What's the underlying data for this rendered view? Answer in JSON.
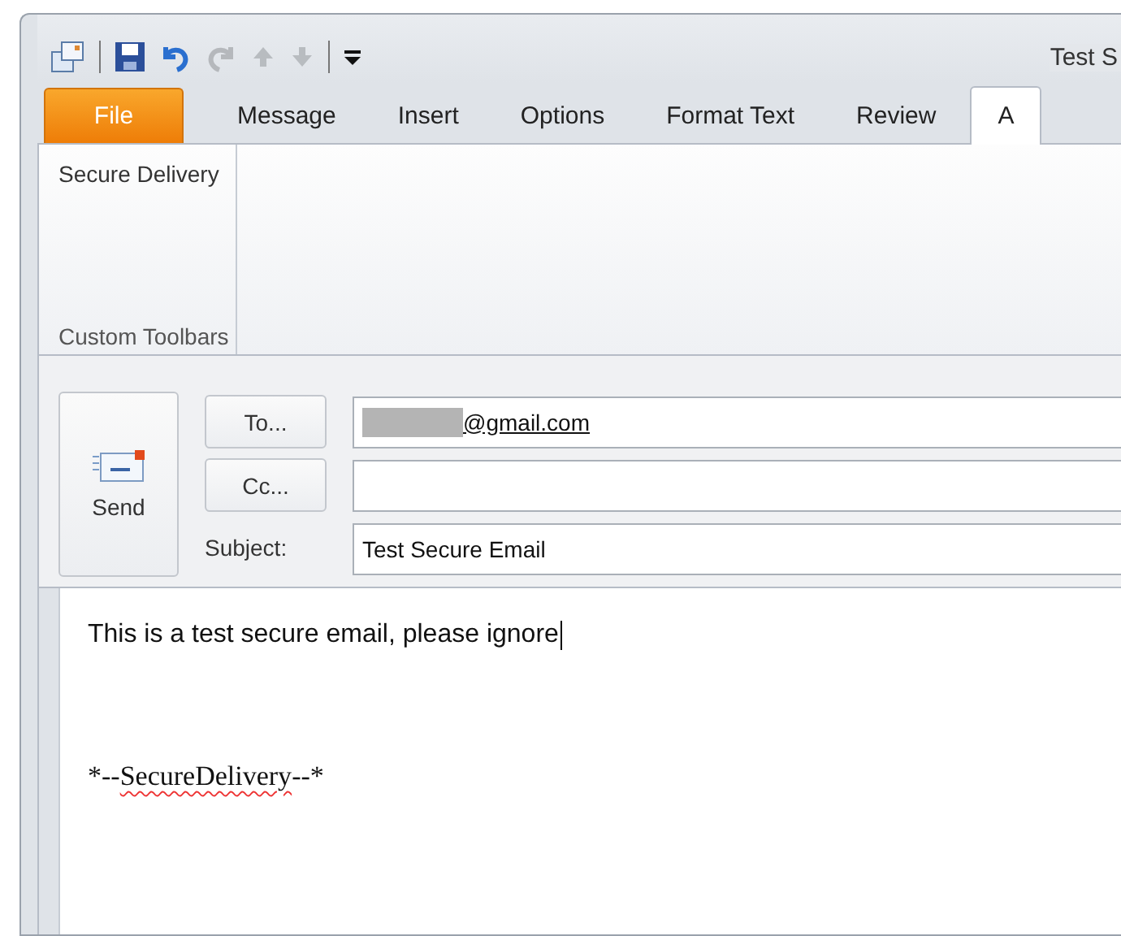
{
  "window": {
    "title": "Test S"
  },
  "tabs": [
    {
      "label": "File",
      "kind": "file",
      "selected": false
    },
    {
      "label": "Message",
      "kind": "tab",
      "selected": false
    },
    {
      "label": "Insert",
      "kind": "tab",
      "selected": false
    },
    {
      "label": "Options",
      "kind": "tab",
      "selected": false
    },
    {
      "label": "Format Text",
      "kind": "tab",
      "selected": false
    },
    {
      "label": "Review",
      "kind": "tab",
      "selected": false
    },
    {
      "label": "A",
      "kind": "tab",
      "selected": true
    }
  ],
  "ribbon": {
    "groups": [
      {
        "label": "Custom Toolbars",
        "buttons": [
          "Secure Delivery"
        ]
      }
    ]
  },
  "header": {
    "send": "Send",
    "fields": [
      {
        "kind": "button",
        "label": "To...",
        "value": "@gmail.com",
        "redacted": true
      },
      {
        "kind": "button",
        "label": "Cc...",
        "redacted": false
      },
      {
        "kind": "label",
        "label": "Subject:",
        "value": "Test Secure Email",
        "redacted": false
      }
    ]
  },
  "body": [
    {
      "kind": "plain",
      "text": "This is a test secure email, please ignore",
      "caret": true
    },
    {
      "kind": "signature",
      "before": "*--",
      "misspelled": "SecureDelivery",
      "after": "--*",
      "caret": false
    }
  ]
}
